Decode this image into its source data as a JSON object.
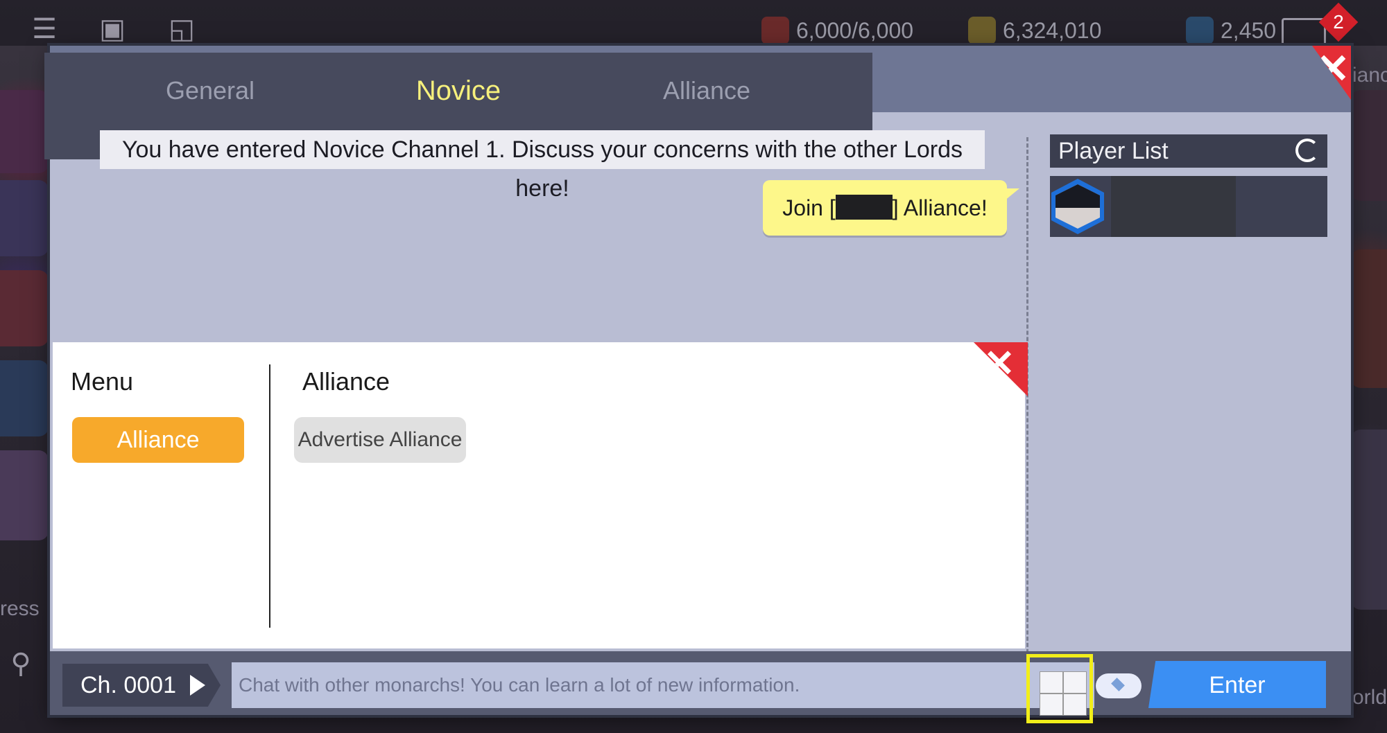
{
  "top_bar": {
    "stamina": "6,000/6,000",
    "gold": "6,324,010",
    "gems": "2,450",
    "mail_badge": "2"
  },
  "edge_labels": {
    "right_top": "ianc",
    "left_bottom": "ress",
    "right_bottom": "orld"
  },
  "tabs": [
    {
      "label": "General",
      "active": false
    },
    {
      "label": "Novice",
      "active": true
    },
    {
      "label": "Alliance",
      "active": false
    }
  ],
  "notice": "You have entered Novice Channel 1. Discuss your concerns with the other Lords here!",
  "bubble": {
    "prefix": "Join [",
    "suffix": "] Alliance!"
  },
  "player_list": {
    "title": "Player List"
  },
  "menu_panel": {
    "menu_title": "Menu",
    "menu_button": "Alliance",
    "section_title": "Alliance",
    "action_button": "Advertise Alliance"
  },
  "bottom_bar": {
    "channel": "Ch. 0001",
    "chat_placeholder": "Chat with other monarchs! You can learn a lot of new information.",
    "enter_label": "Enter"
  },
  "colors": {
    "accent_yellow": "#f2ea62",
    "close_red": "#e42e36",
    "menu_orange": "#f7a92b",
    "enter_blue": "#3b8ff3",
    "highlight_box": "#f2ee1a"
  }
}
